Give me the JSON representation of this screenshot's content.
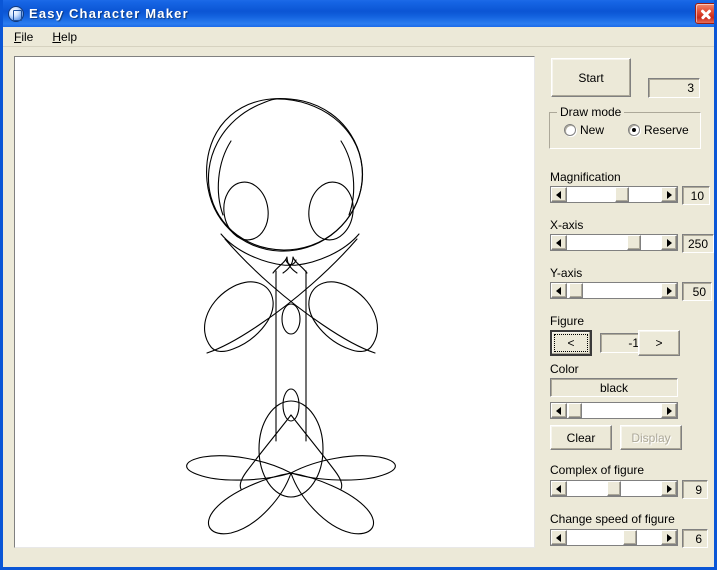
{
  "window": {
    "title": "Easy Character Maker",
    "app_icon": "app-globe-icon",
    "close_label": "close-icon",
    "accent_title_bg": "#0b55d4",
    "face_color": "#ece9d8"
  },
  "menubar": {
    "items": [
      {
        "label": "File",
        "mnemonic": "F"
      },
      {
        "label": "Help",
        "mnemonic": "H"
      }
    ]
  },
  "canvas": {
    "name": "drawing-canvas",
    "background": "#ffffff",
    "stroke": "#000000",
    "figure_description": "spirograph character: head outline with two eye ellipses, crossed arms, narrow body, petal-shaped legs"
  },
  "panel": {
    "start_button": "Start",
    "counter_value": "3",
    "draw_mode": {
      "title": "Draw mode",
      "options": [
        {
          "label": "New",
          "selected": false
        },
        {
          "label": "Reserve",
          "selected": true
        }
      ]
    },
    "magnification": {
      "label": "Magnification",
      "value": "10"
    },
    "x_axis": {
      "label": "X-axis",
      "value": "250"
    },
    "y_axis": {
      "label": "Y-axis",
      "value": "50"
    },
    "figure": {
      "label": "Figure",
      "prev_label": "<",
      "next_label": ">",
      "value": "-1"
    },
    "color": {
      "label": "Color",
      "value": "black"
    },
    "clear_button": "Clear",
    "display_button": "Display",
    "complex": {
      "label": "Complex of figure",
      "value": "9"
    },
    "change_speed": {
      "label": "Change speed of figure",
      "value": "6"
    }
  }
}
